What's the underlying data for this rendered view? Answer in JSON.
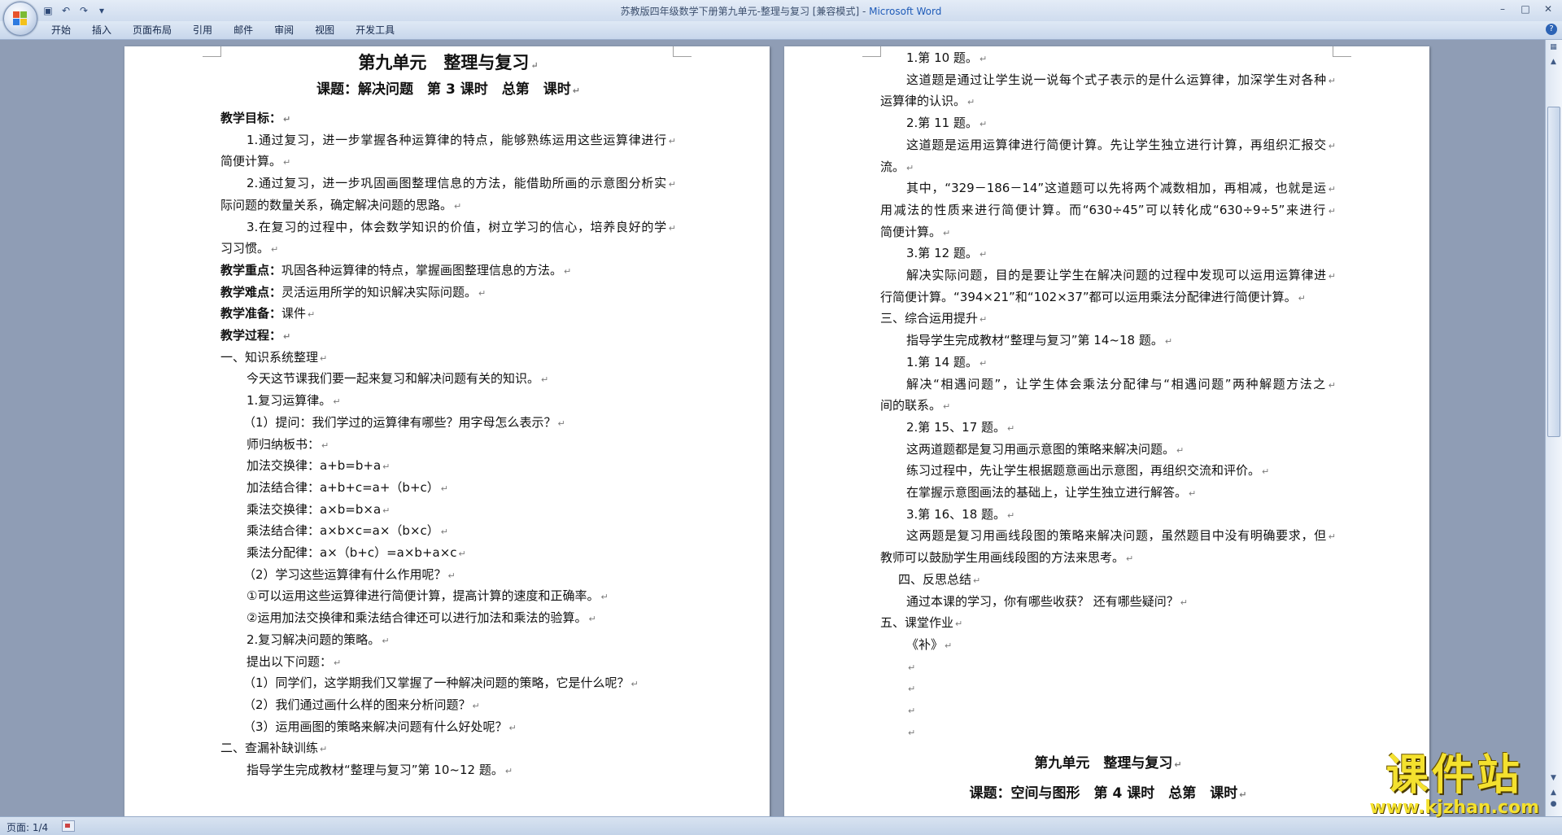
{
  "window": {
    "title_doc": "苏教版四年级数学下册第九单元-整理与复习 [兼容模式]",
    "title_sep": " - ",
    "title_app": "Microsoft Word"
  },
  "ribbon": {
    "tabs": [
      "开始",
      "插入",
      "页面布局",
      "引用",
      "邮件",
      "审阅",
      "视图",
      "开发工具"
    ]
  },
  "status": {
    "page_label": "页面: 1/4"
  },
  "watermark": {
    "main": "课件站",
    "url": "www.kjzhan.com"
  },
  "left_page": [
    {
      "t": "第九单元　整理与复习",
      "c": "h1 center"
    },
    {
      "t": "课题：解决问题　第 3 课时　总第　课时",
      "c": "h2 center"
    },
    {
      "t": "教学目标：",
      "c": "bold"
    },
    {
      "t": "1.通过复习，进一步掌握各种运算律的特点，能够熟练运用这些运算律进行",
      "c": "ind1 justify"
    },
    {
      "t": "简便计算。",
      "c": ""
    },
    {
      "t": "2.通过复习，进一步巩固画图整理信息的方法，能借助所画的示意图分析实",
      "c": "ind1 justify"
    },
    {
      "t": "际问题的数量关系，确定解决问题的思路。",
      "c": ""
    },
    {
      "t": "3.在复习的过程中，体会数学知识的价值，树立学习的信心，培养良好的学",
      "c": "ind1 justify"
    },
    {
      "t": "习习惯。",
      "c": ""
    },
    {
      "lbl": "教学重点：",
      "t": "巩固各种运算律的特点，掌握画图整理信息的方法。",
      "c": ""
    },
    {
      "lbl": "教学难点：",
      "t": "灵活运用所学的知识解决实际问题。",
      "c": ""
    },
    {
      "lbl": "教学准备：",
      "t": "课件",
      "c": ""
    },
    {
      "t": "教学过程：",
      "c": "bold"
    },
    {
      "t": "一、知识系统整理",
      "c": ""
    },
    {
      "t": "今天这节课我们要一起来复习和解决问题有关的知识。",
      "c": "ind1"
    },
    {
      "t": "1.复习运算律。",
      "c": "ind1"
    },
    {
      "t": "（1）提问：我们学过的运算律有哪些？用字母怎么表示？",
      "c": "ind3"
    },
    {
      "t": "师归纳板书：",
      "c": "ind1"
    },
    {
      "t": "加法交换律：a+b=b+a",
      "c": "ind1"
    },
    {
      "t": "加法结合律：a+b+c=a+（b+c）",
      "c": "ind1"
    },
    {
      "t": "乘法交换律：a×b=b×a",
      "c": "ind1"
    },
    {
      "t": "乘法结合律：a×b×c=a×（b×c）",
      "c": "ind1"
    },
    {
      "t": "乘法分配律：a×（b+c）=a×b+a×c",
      "c": "ind1"
    },
    {
      "t": "（2）学习这些运算律有什么作用呢？",
      "c": "ind3"
    },
    {
      "t": "①可以运用这些运算律进行简便计算，提高计算的速度和正确率。",
      "c": "ind1"
    },
    {
      "t": "②运用加法交换律和乘法结合律还可以进行加法和乘法的验算。",
      "c": "ind1"
    },
    {
      "t": "2.复习解决问题的策略。",
      "c": "ind1"
    },
    {
      "t": "提出以下问题：",
      "c": "ind1"
    },
    {
      "t": "（1）同学们，这学期我们又掌握了一种解决问题的策略，它是什么呢？",
      "c": "ind3"
    },
    {
      "t": "（2）我们通过画什么样的图来分析问题？",
      "c": "ind3"
    },
    {
      "t": "（3）运用画图的策略来解决问题有什么好处呢？",
      "c": "ind3"
    },
    {
      "t": "二、查漏补缺训练",
      "c": ""
    },
    {
      "t": "指导学生完成教材“整理与复习”第 10~12 题。",
      "c": "ind1"
    }
  ],
  "right_page": [
    {
      "t": "1.第 10 题。",
      "c": "ind1"
    },
    {
      "t": "这道题是通过让学生说一说每个式子表示的是什么运算律，加深学生对各种",
      "c": "ind1 justify"
    },
    {
      "t": "运算律的认识。",
      "c": ""
    },
    {
      "t": "2.第 11 题。",
      "c": "ind1"
    },
    {
      "t": "这道题是运用运算律进行简便计算。先让学生独立进行计算，再组织汇报交",
      "c": "ind1 justify"
    },
    {
      "t": "流。",
      "c": ""
    },
    {
      "t": "其中，“329－186－14”这道题可以先将两个减数相加，再相减，也就是运",
      "c": "ind1 justify"
    },
    {
      "t": "用减法的性质来进行简便计算。而“630÷45”可以转化成“630÷9÷5”来进行",
      "c": "justify"
    },
    {
      "t": "简便计算。",
      "c": ""
    },
    {
      "t": "3.第 12 题。",
      "c": "ind1"
    },
    {
      "t": "解决实际问题，目的是要让学生在解决问题的过程中发现可以运用运算律进",
      "c": "ind1 justify"
    },
    {
      "t": "行简便计算。“394×21”和“102×37”都可以运用乘法分配律进行简便计算。",
      "c": ""
    },
    {
      "t": "三、综合运用提升",
      "c": ""
    },
    {
      "t": "指导学生完成教材“整理与复习”第 14~18 题。",
      "c": "ind1"
    },
    {
      "t": "1.第 14 题。",
      "c": "ind1"
    },
    {
      "t": "解决“相遇问题”，让学生体会乘法分配律与“相遇问题”两种解题方法之",
      "c": "ind1 justify"
    },
    {
      "t": "间的联系。",
      "c": ""
    },
    {
      "t": "2.第 15、17 题。",
      "c": "ind1"
    },
    {
      "t": "这两道题都是复习用画示意图的策略来解决问题。",
      "c": "ind1"
    },
    {
      "t": "练习过程中，先让学生根据题意画出示意图，再组织交流和评价。",
      "c": "ind1"
    },
    {
      "t": "在掌握示意图画法的基础上，让学生独立进行解答。",
      "c": "ind1"
    },
    {
      "t": "3.第 16、18 题。",
      "c": "ind1"
    },
    {
      "t": "这两题是复习用画线段图的策略来解决问题，虽然题目中没有明确要求，但",
      "c": "ind1 justify"
    },
    {
      "t": "教师可以鼓励学生用画线段图的方法来思考。",
      "c": ""
    },
    {
      "t": "四、反思总结",
      "c": "ind2"
    },
    {
      "t": "通过本课的学习，你有哪些收获？ 还有哪些疑问？",
      "c": "ind1"
    },
    {
      "t": "五、课堂作业",
      "c": ""
    },
    {
      "t": "《补》",
      "c": "ind1"
    },
    {
      "t": "",
      "c": "ind1"
    },
    {
      "t": "",
      "c": "ind1"
    },
    {
      "t": "",
      "c": "ind1"
    },
    {
      "t": "",
      "c": "ind1"
    },
    {
      "t": "第九单元　整理与复习",
      "c": "h2 center"
    },
    {
      "t": "课题：空间与图形　第 4 课时　总第　课时",
      "c": "h2 center"
    }
  ]
}
